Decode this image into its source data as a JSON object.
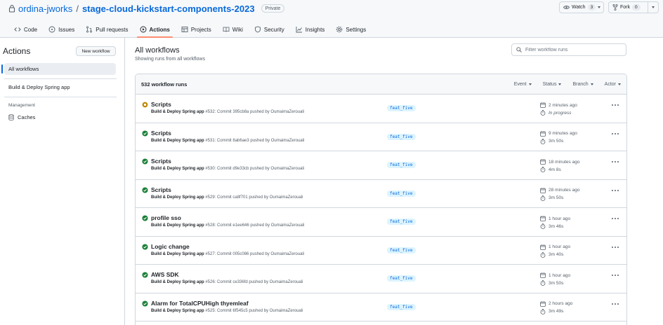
{
  "repo": {
    "owner": "ordina-jworks",
    "separator": "/",
    "name": "stage-cloud-kickstart-components-2023",
    "visibility": "Private",
    "watch_label": "Watch",
    "watch_count": "3",
    "fork_label": "Fork",
    "fork_count": "0"
  },
  "tabs": [
    {
      "label": "Code",
      "icon": "code-icon"
    },
    {
      "label": "Issues",
      "icon": "issue-icon"
    },
    {
      "label": "Pull requests",
      "icon": "pull-request-icon"
    },
    {
      "label": "Actions",
      "icon": "play-icon",
      "active": true
    },
    {
      "label": "Projects",
      "icon": "table-icon"
    },
    {
      "label": "Wiki",
      "icon": "book-icon"
    },
    {
      "label": "Security",
      "icon": "shield-icon"
    },
    {
      "label": "Insights",
      "icon": "graph-icon"
    },
    {
      "label": "Settings",
      "icon": "gear-icon"
    }
  ],
  "sidebar": {
    "title": "Actions",
    "new_workflow": "New workflow",
    "all_workflows": "All workflows",
    "workflow": "Build & Deploy Spring app",
    "management_heading": "Management",
    "caches": "Caches"
  },
  "main": {
    "title": "All workflows",
    "subtitle": "Showing runs from all workflows",
    "filter_placeholder": "Filter workflow runs",
    "run_count": "532 workflow runs",
    "filters": [
      "Event",
      "Status",
      "Branch",
      "Actor"
    ]
  },
  "runs": [
    {
      "title": "Scripts",
      "workflow": "Build & Deploy Spring app",
      "meta": "#532: Commit 395cb8a pushed by OumaimaZerouali",
      "branch": "feat_five",
      "time": "2 minutes ago",
      "duration": "In progress",
      "status": "in_progress"
    },
    {
      "title": "Scripts",
      "workflow": "Build & Deploy Spring app",
      "meta": "#531: Commit 8ab6ae3 pushed by OumaimaZerouali",
      "branch": "feat_five",
      "time": "9 minutes ago",
      "duration": "3m 50s",
      "status": "success"
    },
    {
      "title": "Scripts",
      "workflow": "Build & Deploy Spring app",
      "meta": "#530: Commit d9e33cb pushed by OumaimaZerouali",
      "branch": "feat_five",
      "time": "18 minutes ago",
      "duration": "4m 8s",
      "status": "success"
    },
    {
      "title": "Scripts",
      "workflow": "Build & Deploy Spring app",
      "meta": "#529: Commit ca8f701 pushed by OumaimaZerouali",
      "branch": "feat_five",
      "time": "28 minutes ago",
      "duration": "3m 50s",
      "status": "success"
    },
    {
      "title": "profile sso",
      "workflow": "Build & Deploy Spring app",
      "meta": "#528: Commit e1ee646 pushed by OumaimaZerouali",
      "branch": "feat_five",
      "time": "1 hour ago",
      "duration": "3m 46s",
      "status": "success"
    },
    {
      "title": "Logic change",
      "workflow": "Build & Deploy Spring app",
      "meta": "#527: Commit 005c086 pushed by OumaimaZerouali",
      "branch": "feat_five",
      "time": "1 hour ago",
      "duration": "3m 40s",
      "status": "success"
    },
    {
      "title": "AWS SDK",
      "workflow": "Build & Deploy Spring app",
      "meta": "#526: Commit ce336fd pushed by OumaimaZerouali",
      "branch": "feat_five",
      "time": "1 hour ago",
      "duration": "3m 50s",
      "status": "success"
    },
    {
      "title": "Alarm for TotalCPUHigh thyemleaf",
      "workflow": "Build & Deploy Spring app",
      "meta": "#525: Commit 6f545c5 pushed by OumaimaZerouali",
      "branch": "feat_five",
      "time": "2 hours ago",
      "duration": "3m 49s",
      "status": "success"
    }
  ],
  "colors": {
    "accent": "#0969da",
    "success": "#1a7f37",
    "in_progress": "#bf8700",
    "active_tab": "#fd8c73"
  }
}
